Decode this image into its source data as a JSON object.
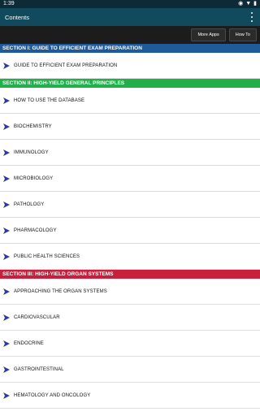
{
  "status": {
    "time": "1:39"
  },
  "appbar": {
    "title": "Contents"
  },
  "toolbar": {
    "more_apps": "More Apps",
    "how_to": "How To"
  },
  "sections": [
    {
      "title": "SECTION I: GUIDE TO EFFICIENT EXAM PREPARATION",
      "color": "#1f5a9a",
      "items": [
        "GUIDE TO EFFICIENT EXAM PREPARATION"
      ]
    },
    {
      "title": "SECTION II: HIGH-YIELD GENERAL PRINCIPLES",
      "color": "#1fb04a",
      "items": [
        "HOW TO USE THE DATABASE",
        "BIOCHEMISTRY",
        "IMMUNOLOGY",
        "MICROBIOLOGY",
        "PATHOLOGY",
        "PHARMACOLOGY",
        "PUBLIC HEALTH SCIENCES"
      ]
    },
    {
      "title": "SECTION III: HIGH-YIELD ORGAN SYSTEMS",
      "color": "#c8203c",
      "items": [
        "APPROACHING THE ORGAN SYSTEMS",
        "CARDIOVASCULAR",
        "ENDOCRINE",
        "GASTROINTESTINAL",
        "HEMATOLOGY AND ONCOLOGY"
      ]
    }
  ],
  "colors": {
    "arrow": "#2a3a9a",
    "appbar": "#114a5c",
    "statusbar": "#0d2a36"
  }
}
